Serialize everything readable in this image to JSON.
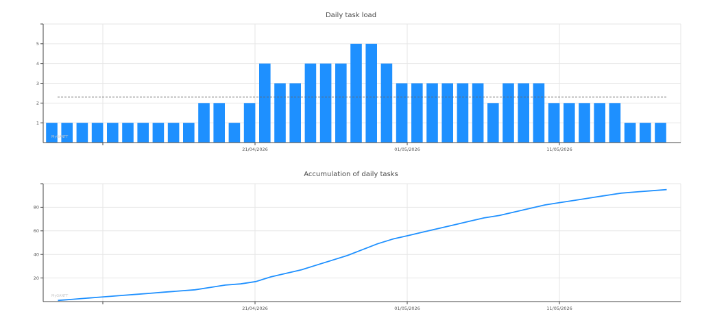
{
  "watermark": "MyGANTT",
  "colors": {
    "accent": "#1e90ff",
    "axis": "#444444",
    "grid": "#e6e6e6",
    "average_line": "#666666"
  },
  "chart_data": [
    {
      "type": "bar",
      "title": "Daily task load",
      "xlabel": "",
      "ylabel": "",
      "ylim": [
        0,
        6
      ],
      "yticks": [
        1,
        2,
        3,
        4,
        5
      ],
      "x_tick_labels": [
        "21/04/2026",
        "01/05/2026",
        "11/05/2026"
      ],
      "grid": true,
      "average_line": 2.3,
      "values": [
        1,
        1,
        1,
        1,
        1,
        1,
        1,
        1,
        1,
        1,
        2,
        2,
        1,
        2,
        4,
        3,
        3,
        4,
        4,
        4,
        5,
        5,
        4,
        3,
        3,
        3,
        3,
        3,
        3,
        2,
        3,
        3,
        3,
        2,
        2,
        2,
        2,
        2,
        1,
        1,
        1
      ]
    },
    {
      "type": "line",
      "title": "Accumulation of daily tasks",
      "xlabel": "",
      "ylabel": "",
      "ylim": [
        0,
        100
      ],
      "yticks": [
        20,
        40,
        60,
        80
      ],
      "x_tick_labels": [
        "21/04/2026",
        "01/05/2026",
        "11/05/2026"
      ],
      "grid": true,
      "values": [
        1,
        2,
        3,
        4,
        5,
        6,
        7,
        8,
        9,
        10,
        12,
        14,
        15,
        17,
        21,
        24,
        27,
        31,
        35,
        39,
        44,
        49,
        53,
        56,
        59,
        62,
        65,
        68,
        71,
        73,
        76,
        79,
        82,
        84,
        86,
        88,
        90,
        92,
        93,
        94,
        95
      ]
    }
  ]
}
